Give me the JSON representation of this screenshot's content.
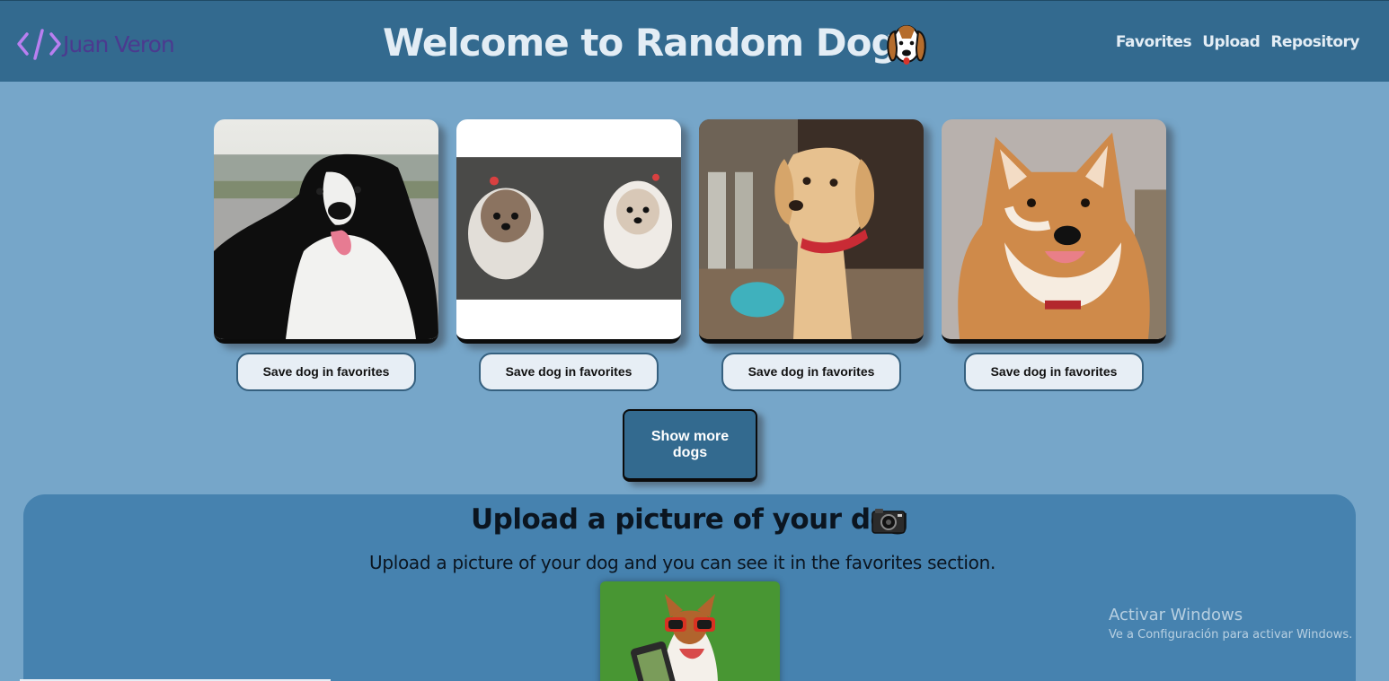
{
  "header": {
    "brand_name": "Juan Veron",
    "title": "Welcome to Random Dogs",
    "nav": [
      "Favorites",
      "Upload",
      "Repository"
    ]
  },
  "dogs": [
    {
      "breed_icon": "border-collie-photo",
      "save_label": "Save dog in favorites"
    },
    {
      "breed_icon": "havanese-pair-photo",
      "save_label": "Save dog in favorites"
    },
    {
      "breed_icon": "golden-retriever-puppy-photo",
      "save_label": "Save dog in favorites"
    },
    {
      "breed_icon": "shiba-inu-photo",
      "save_label": "Save dog in favorites"
    }
  ],
  "show_more_label": "Show more dogs",
  "upload": {
    "title": "Upload a picture of your dog",
    "description": "Upload a picture of your dog and you can see it in the favorites section."
  },
  "watermark": {
    "title": "Activar Windows",
    "subtitle": "Ve a Configuración para activar Windows."
  },
  "colors": {
    "page_bg": "#76a6c9",
    "header_bg": "#336a8f",
    "section_bg": "#4682af",
    "brand": "#4b3a8f"
  }
}
